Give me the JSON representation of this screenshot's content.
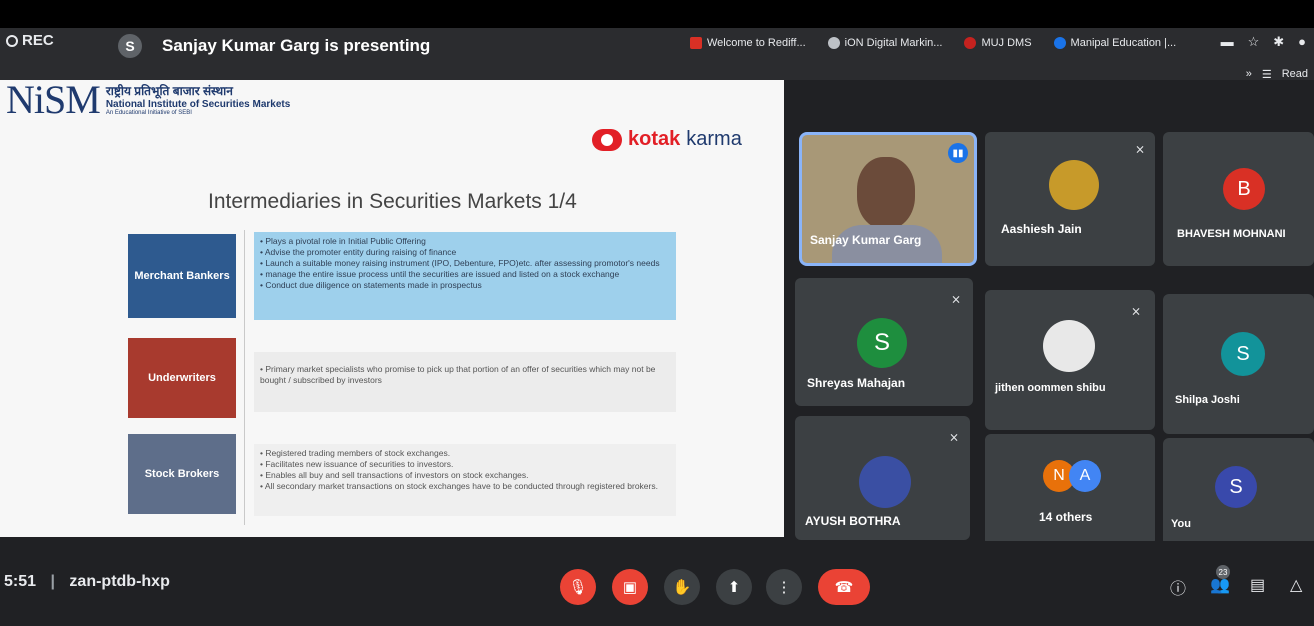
{
  "meet": {
    "rec_label": "REC",
    "presenter_initial": "S",
    "presenter_text": "Sanjay Kumar Garg is presenting",
    "meeting_time": "5:51",
    "meeting_code": "zan-ptdb-hxp",
    "participant_count": "23"
  },
  "browser": {
    "bookmarks": [
      {
        "label": "Welcome to Rediff...",
        "icon": "rediff-icon"
      },
      {
        "label": "iON Digital Markin...",
        "icon": "ion-icon"
      },
      {
        "label": "MUJ DMS",
        "icon": "lotus-icon"
      },
      {
        "label": "Manipal Education |...",
        "icon": "manipal-icon"
      }
    ],
    "reading_label": "Read"
  },
  "slide": {
    "org_mark": "NiSM",
    "org_hindi": "राष्ट्रीय प्रतिभूति बाजार संस्थान",
    "org_name": "National Institute of Securities Markets",
    "org_sub": "An Educational Initiative of SEBI",
    "sponsor_name": "kotak",
    "sponsor_suffix": "karma",
    "title": "Intermediaries in Securities Markets 1/4",
    "rows": [
      {
        "category": "Merchant Bankers",
        "points": [
          "• Plays a pivotal role in Initial Public Offering",
          "• Advise the promoter entity during raising of finance",
          "• Launch a suitable money raising instrument (IPO, Debenture, FPO)etc. after assessing promotor's needs",
          "• manage the entire issue process until the securities are issued and listed on a stock exchange",
          "• Conduct due diligence on statements made in prospectus"
        ]
      },
      {
        "category": "Underwriters",
        "points": [
          "• Primary market specialists who promise to pick up that portion of an offer of securities which may not be bought / subscribed by investors"
        ]
      },
      {
        "category": "Stock Brokers",
        "points": [
          "• Registered trading members of stock exchanges.",
          "• Facilitates new issuance of securities to investors.",
          "• Enables all buy and sell transactions of investors on stock exchanges.",
          "• All secondary market transactions on stock exchanges have to be conducted through registered brokers."
        ]
      }
    ]
  },
  "participants": [
    {
      "name": "Sanjay Kumar Garg",
      "initial": "",
      "color": "",
      "muted": false
    },
    {
      "name": "Aashiesh Jain",
      "initial": "",
      "color": "#c79a2a",
      "muted": true
    },
    {
      "name": "BHAVESH MOHNANI",
      "initial": "B",
      "color": "#d93025",
      "muted": false
    },
    {
      "name": "Shreyas Mahajan",
      "initial": "S",
      "color": "#1e8e3e",
      "muted": true
    },
    {
      "name": "jithen oommen shibu",
      "initial": "",
      "color": "#e8e8e8",
      "muted": true
    },
    {
      "name": "Shilpa Joshi",
      "initial": "S",
      "color": "#12939a",
      "muted": false
    },
    {
      "name": "AYUSH BOTHRA",
      "initial": "",
      "color": "#3a4fa3",
      "muted": true
    },
    {
      "name": "14 others",
      "initials": [
        "N",
        "A"
      ],
      "colors": [
        "#e8710a",
        "#4285f4"
      ]
    },
    {
      "name": "You",
      "initial": "S",
      "color": "#3949ab",
      "muted": false
    }
  ],
  "colors": {
    "background": "#202124",
    "tile": "#3c4043",
    "end_call": "#ea4335",
    "speaking": "#8ab4f8"
  }
}
